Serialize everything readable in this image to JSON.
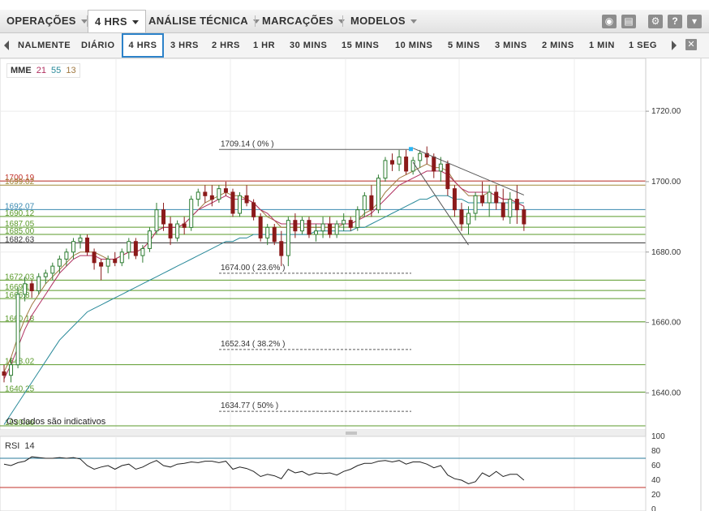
{
  "menu": {
    "items": [
      {
        "label": "OPERAÇÕES",
        "dropdown": true,
        "active": false
      },
      {
        "label": "4 HRS",
        "dropdown": true,
        "active": true
      },
      {
        "label": "ANÁLISE TÉCNICA",
        "dropdown": true,
        "active": false
      },
      {
        "label": "MARCAÇÕES",
        "dropdown": true,
        "active": false
      },
      {
        "label": "MODELOS",
        "dropdown": true,
        "active": false
      }
    ],
    "tools": [
      "camera-icon",
      "print-icon",
      "gear-icon",
      "help-icon",
      "collapse-icon"
    ]
  },
  "timeframes": {
    "items": [
      "NALMENTE",
      "DIÁRIO",
      "4 HRS",
      "3 HRS",
      "2 HRS",
      "1 HR",
      "30 MINS",
      "15 MINS",
      "10 MINS",
      "5 MINS",
      "3 MINS",
      "2 MINS",
      "1 MIN",
      "1 SEG"
    ],
    "active": "4 HRS"
  },
  "indicator": {
    "label": "MME",
    "p1": "21",
    "p2": "55",
    "p3": "13"
  },
  "rsi": {
    "label": "RSI",
    "period": "14"
  },
  "notice": "Os dados são indicativos",
  "colors": {
    "up": "#2e7d32",
    "down": "#8b1a1a",
    "ema21": "#b03060",
    "ema55": "#2a8a9a",
    "ema13": "#a07840",
    "green_level": "#5a9a2a",
    "olive_level": "#a08c3a",
    "red_level": "#c0302a",
    "blue_level": "#3a8ab0",
    "fib": "#5a5a5a",
    "rsi_line": "#222222",
    "rsi_upper": "#2a7a9a",
    "rsi_lower": "#c0302a"
  },
  "chart_data": [
    {
      "type": "candlestick",
      "y_axis": {
        "ticks": [
          "1720.00",
          "1700.00",
          "1680.00",
          "1660.00",
          "1640.00"
        ],
        "ylim": [
          1629.5,
          1735.0
        ]
      },
      "ohlc": [
        [
          1646,
          1648,
          1643,
          1645
        ],
        [
          1645,
          1650,
          1643,
          1648
        ],
        [
          1648,
          1670,
          1647,
          1668
        ],
        [
          1668,
          1673,
          1666,
          1671
        ],
        [
          1671,
          1672,
          1667,
          1669
        ],
        [
          1669,
          1674,
          1668,
          1673
        ],
        [
          1673,
          1675,
          1671,
          1674
        ],
        [
          1674,
          1677,
          1672,
          1676
        ],
        [
          1676,
          1679,
          1674,
          1678
        ],
        [
          1678,
          1681,
          1676,
          1680
        ],
        [
          1680,
          1684,
          1678,
          1683
        ],
        [
          1683,
          1685,
          1681,
          1684
        ],
        [
          1684,
          1685,
          1679,
          1680
        ],
        [
          1680,
          1681,
          1675,
          1677
        ],
        [
          1677,
          1678,
          1672,
          1676
        ],
        [
          1676,
          1679,
          1674,
          1678
        ],
        [
          1678,
          1680,
          1676,
          1677
        ],
        [
          1677,
          1681,
          1676,
          1680
        ],
        [
          1680,
          1684,
          1678,
          1683
        ],
        [
          1683,
          1684,
          1678,
          1679
        ],
        [
          1679,
          1682,
          1677,
          1681
        ],
        [
          1681,
          1687,
          1680,
          1686
        ],
        [
          1686,
          1694,
          1685,
          1692
        ],
        [
          1692,
          1694,
          1686,
          1688
        ],
        [
          1688,
          1690,
          1682,
          1684
        ],
        [
          1684,
          1689,
          1683,
          1688
        ],
        [
          1688,
          1690,
          1685,
          1687
        ],
        [
          1687,
          1696,
          1686,
          1695
        ],
        [
          1695,
          1698,
          1693,
          1697
        ],
        [
          1697,
          1699,
          1694,
          1696
        ],
        [
          1696,
          1699,
          1693,
          1695
        ],
        [
          1695,
          1699,
          1694,
          1698
        ],
        [
          1698,
          1700,
          1696,
          1697
        ],
        [
          1697,
          1698,
          1690,
          1691
        ],
        [
          1691,
          1697,
          1690,
          1696
        ],
        [
          1696,
          1699,
          1693,
          1694
        ],
        [
          1694,
          1695,
          1689,
          1690
        ],
        [
          1690,
          1691,
          1683,
          1684
        ],
        [
          1684,
          1688,
          1682,
          1687
        ],
        [
          1687,
          1688,
          1682,
          1683
        ],
        [
          1683,
          1686,
          1676,
          1679
        ],
        [
          1679,
          1690,
          1676,
          1689
        ],
        [
          1689,
          1691,
          1684,
          1686
        ],
        [
          1686,
          1690,
          1685,
          1689
        ],
        [
          1689,
          1690,
          1684,
          1685
        ],
        [
          1685,
          1688,
          1683,
          1686
        ],
        [
          1686,
          1690,
          1684,
          1688
        ],
        [
          1688,
          1690,
          1684,
          1685
        ],
        [
          1685,
          1689,
          1684,
          1688
        ],
        [
          1688,
          1691,
          1686,
          1689
        ],
        [
          1689,
          1690,
          1686,
          1687
        ],
        [
          1687,
          1693,
          1686,
          1692
        ],
        [
          1692,
          1697,
          1690,
          1696
        ],
        [
          1696,
          1699,
          1690,
          1692
        ],
        [
          1692,
          1702,
          1691,
          1701
        ],
        [
          1701,
          1707,
          1700,
          1706
        ],
        [
          1706,
          1708,
          1703,
          1705
        ],
        [
          1705,
          1709,
          1703,
          1707
        ],
        [
          1707,
          1709,
          1702,
          1703
        ],
        [
          1703,
          1707,
          1702,
          1706
        ],
        [
          1706,
          1709,
          1704,
          1708
        ],
        [
          1708,
          1710,
          1705,
          1707
        ],
        [
          1707,
          1708,
          1701,
          1703
        ],
        [
          1703,
          1707,
          1700,
          1705
        ],
        [
          1705,
          1706,
          1696,
          1698
        ],
        [
          1698,
          1699,
          1690,
          1692
        ],
        [
          1692,
          1694,
          1686,
          1688
        ],
        [
          1688,
          1693,
          1685,
          1691
        ],
        [
          1691,
          1697,
          1689,
          1696
        ],
        [
          1696,
          1700,
          1693,
          1694
        ],
        [
          1694,
          1699,
          1690,
          1697
        ],
        [
          1697,
          1699,
          1692,
          1694
        ],
        [
          1694,
          1698,
          1689,
          1690
        ],
        [
          1690,
          1697,
          1688,
          1695
        ],
        [
          1695,
          1699,
          1688,
          1692
        ],
        [
          1692,
          1693,
          1686,
          1688
        ]
      ],
      "ema21": [
        1644,
        1648,
        1653,
        1658,
        1662,
        1665,
        1668,
        1671,
        1674,
        1676,
        1678,
        1679,
        1679,
        1679,
        1678,
        1678,
        1678,
        1679,
        1680,
        1680,
        1681,
        1683,
        1686,
        1687,
        1687,
        1687,
        1688,
        1690,
        1692,
        1693,
        1694,
        1695,
        1696,
        1695,
        1695,
        1695,
        1694,
        1692,
        1691,
        1689,
        1688,
        1688,
        1688,
        1688,
        1688,
        1688,
        1688,
        1688,
        1688,
        1688,
        1688,
        1689,
        1690,
        1691,
        1693,
        1695,
        1697,
        1699,
        1700,
        1701,
        1702,
        1703,
        1703,
        1703,
        1702,
        1700,
        1698,
        1697,
        1697,
        1697,
        1697,
        1696,
        1695,
        1695,
        1694,
        1693
      ],
      "ema55": [
        1631,
        1634,
        1637,
        1640,
        1643,
        1646,
        1649,
        1652,
        1655,
        1657,
        1659,
        1661,
        1663,
        1664,
        1665,
        1666,
        1667,
        1668,
        1669,
        1670,
        1671,
        1672,
        1673,
        1674,
        1675,
        1676,
        1677,
        1678,
        1679,
        1680,
        1681,
        1682,
        1683,
        1683,
        1684,
        1684,
        1685,
        1685,
        1685,
        1685,
        1685,
        1685,
        1685,
        1685,
        1685,
        1686,
        1686,
        1686,
        1686,
        1686,
        1686,
        1687,
        1687,
        1688,
        1689,
        1690,
        1691,
        1692,
        1693,
        1694,
        1695,
        1695,
        1696,
        1696,
        1696,
        1695,
        1695,
        1694,
        1694,
        1694,
        1694,
        1694,
        1694,
        1694,
        1694,
        1694
      ],
      "ema13": [
        1646,
        1650,
        1656,
        1661,
        1665,
        1668,
        1671,
        1673,
        1675,
        1677,
        1679,
        1680,
        1680,
        1680,
        1679,
        1678,
        1678,
        1679,
        1680,
        1680,
        1681,
        1683,
        1686,
        1687,
        1687,
        1687,
        1688,
        1690,
        1692,
        1694,
        1695,
        1696,
        1697,
        1696,
        1696,
        1695,
        1694,
        1692,
        1690,
        1689,
        1687,
        1687,
        1687,
        1687,
        1687,
        1687,
        1687,
        1687,
        1687,
        1688,
        1688,
        1689,
        1691,
        1692,
        1694,
        1697,
        1699,
        1701,
        1702,
        1703,
        1704,
        1705,
        1704,
        1704,
        1703,
        1700,
        1698,
        1696,
        1696,
        1696,
        1697,
        1696,
        1695,
        1695,
        1694,
        1693
      ],
      "levels": [
        {
          "label": "1700.19",
          "value": 1700.19,
          "color": "red"
        },
        {
          "label": "1699.02",
          "value": 1699.02,
          "color": "olive"
        },
        {
          "label": "1692.07",
          "value": 1692.07,
          "color": "blue"
        },
        {
          "label": "1690.12",
          "value": 1690.12,
          "color": "green"
        },
        {
          "label": "1687.05",
          "value": 1687.05,
          "color": "green"
        },
        {
          "label": "1685.00",
          "value": 1685.0,
          "color": "green"
        },
        {
          "label": "1682.63",
          "value": 1682.63,
          "color": "dark"
        },
        {
          "label": "1672.03",
          "value": 1672.03,
          "color": "green"
        },
        {
          "label": "1669.1",
          "value": 1669.1,
          "color": "green"
        },
        {
          "label": "1666.8",
          "value": 1666.8,
          "color": "green"
        },
        {
          "label": "1660.18",
          "value": 1660.18,
          "color": "green"
        },
        {
          "label": "1648.02",
          "value": 1648.02,
          "color": "green"
        },
        {
          "label": "1640.25",
          "value": 1640.25,
          "color": "green"
        },
        {
          "label": "1630.66",
          "value": 1630.66,
          "color": "green"
        }
      ],
      "fibonacci": [
        {
          "label": "1709.14 ( 0% )",
          "value": 1709.14,
          "solid": true
        },
        {
          "label": "1674.00 ( 23.6% )",
          "value": 1674.0
        },
        {
          "label": "1652.34 ( 38.2% )",
          "value": 1652.34
        },
        {
          "label": "1634.77 ( 50% )",
          "value": 1634.77
        }
      ],
      "trendlines": [
        {
          "from": [
            59,
            1709.5
          ],
          "to": [
            75,
            1696.2
          ]
        },
        {
          "from": [
            59,
            1705.5
          ],
          "to": [
            67,
            1682.0
          ]
        }
      ]
    },
    {
      "type": "line",
      "title": "RSI 14",
      "y_axis": {
        "ticks": [
          "100",
          "80",
          "60",
          "40",
          "20",
          "0"
        ],
        "ylim": [
          0,
          100
        ]
      },
      "levels": [
        70,
        30
      ],
      "values": [
        62,
        60,
        64,
        66,
        72,
        71,
        70,
        70,
        71,
        70,
        71,
        69,
        60,
        55,
        58,
        60,
        55,
        60,
        62,
        55,
        58,
        63,
        67,
        60,
        58,
        62,
        63,
        65,
        64,
        66,
        66,
        64,
        66,
        55,
        58,
        56,
        52,
        45,
        48,
        46,
        42,
        55,
        50,
        52,
        47,
        50,
        49,
        50,
        47,
        52,
        55,
        60,
        63,
        63,
        66,
        67,
        65,
        67,
        62,
        65,
        65,
        62,
        57,
        60,
        47,
        42,
        40,
        35,
        38,
        50,
        45,
        52,
        45,
        48,
        48,
        40
      ]
    }
  ]
}
